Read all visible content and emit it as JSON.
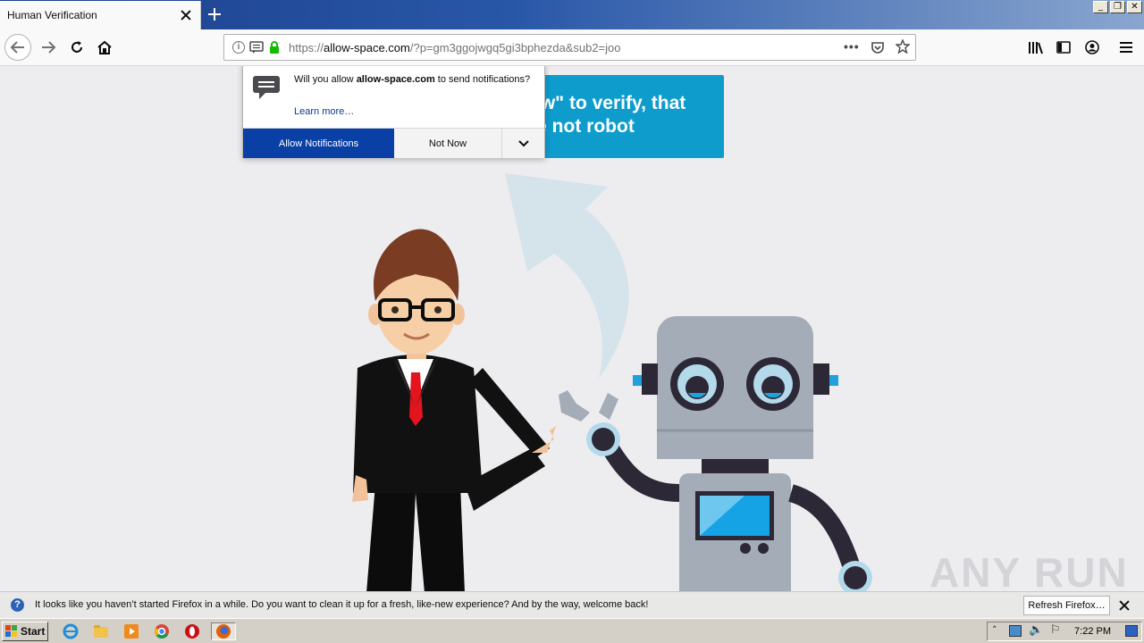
{
  "browser": {
    "tab": {
      "title": "Human Verification"
    },
    "url": {
      "prefix": "https://",
      "domain": "allow-space.com",
      "path": "/?p=gm3ggojwgq5gi3bphezda&sub2=joo"
    },
    "window_buttons": [
      "_",
      "❐",
      "✕"
    ]
  },
  "page": {
    "banner_line1": "ow\" to verify, that",
    "banner_line2": "re not robot"
  },
  "permission_popup": {
    "message_before": "Will you allow ",
    "message_domain": "allow-space.com",
    "message_after": " to send notifications?",
    "learn_more": "Learn more…",
    "allow_label": "Allow Notifications",
    "not_now_label": "Not Now"
  },
  "notification_bar": {
    "text": "It looks like you haven’t started Firefox in a while. Do you want to clean it up for a fresh, like-new experience? And by the way, welcome back!",
    "refresh_label": "Refresh Firefox…"
  },
  "taskbar": {
    "start_label": "Start",
    "clock": "7:22 PM"
  },
  "watermark": "ANY RUN",
  "colors": {
    "banner": "#0e9ccd",
    "allow_button": "#0a3fa6",
    "titlebar": "#1b3f8a"
  }
}
